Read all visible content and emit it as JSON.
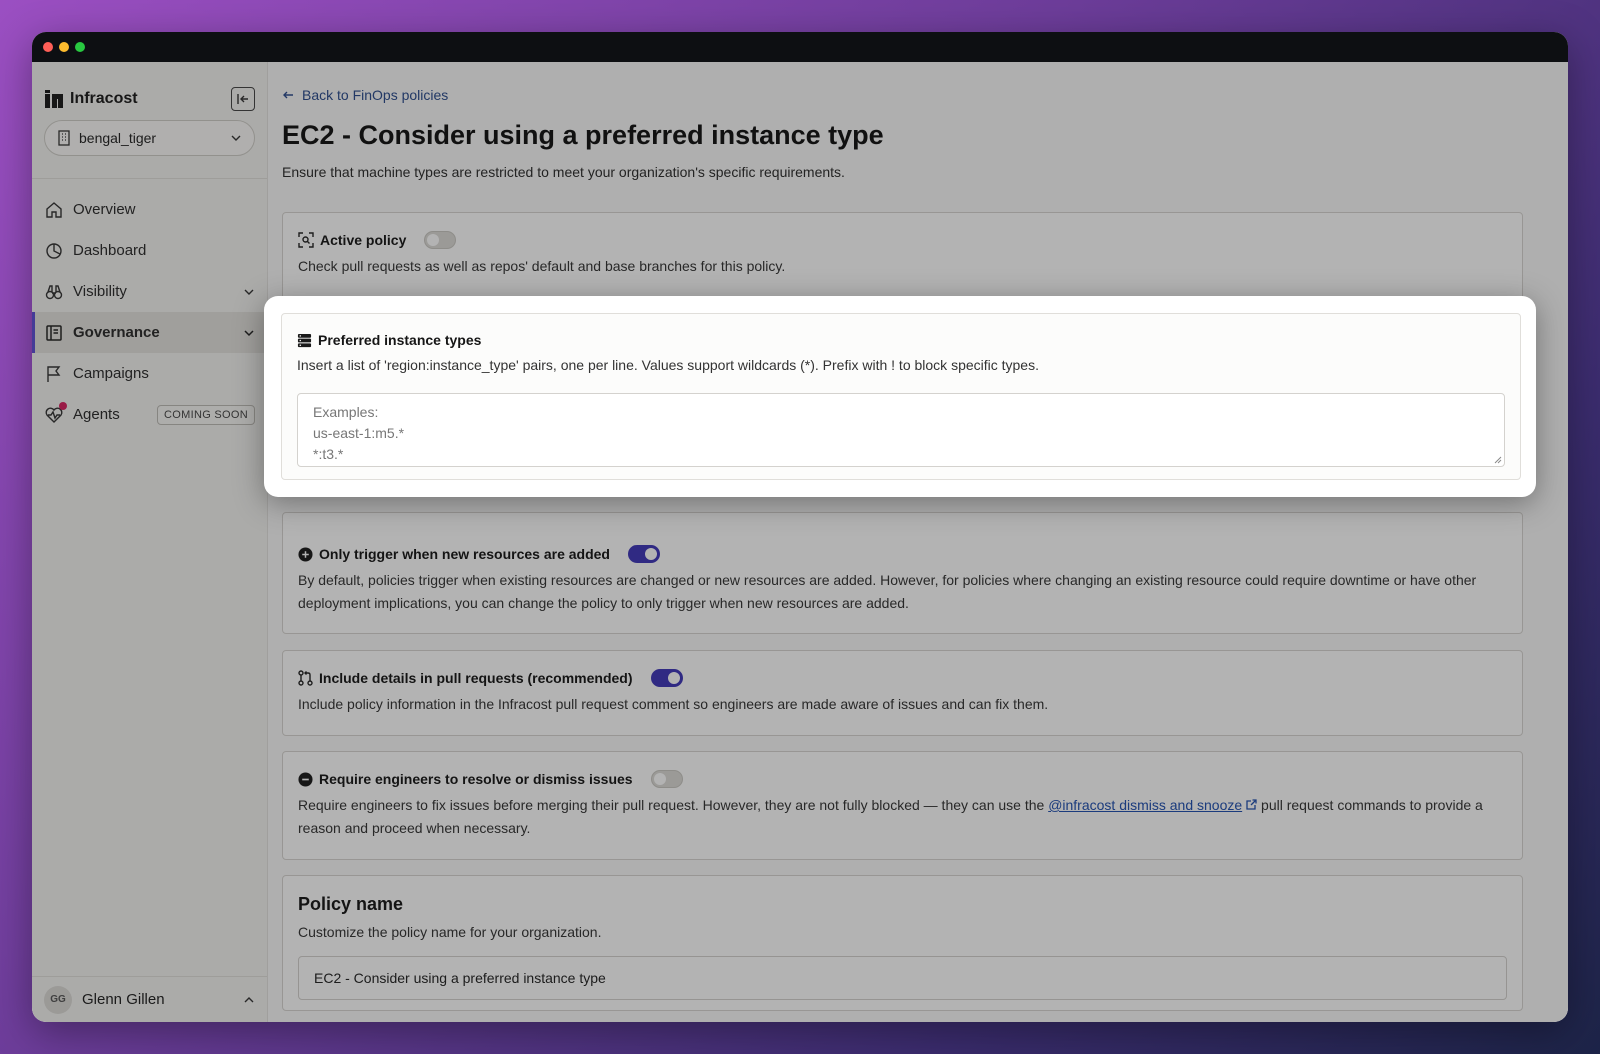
{
  "brand": {
    "name": "Infracost"
  },
  "org": {
    "name": "bengal_tiger"
  },
  "nav": {
    "items": [
      {
        "label": "Overview",
        "icon": "home-icon"
      },
      {
        "label": "Dashboard",
        "icon": "pie-chart-icon"
      },
      {
        "label": "Visibility",
        "icon": "binoculars-icon"
      },
      {
        "label": "Governance",
        "icon": "book-icon"
      },
      {
        "label": "Campaigns",
        "icon": "flag-icon"
      },
      {
        "label": "Agents",
        "icon": "heart-pulse-icon",
        "badge": "COMING SOON"
      }
    ]
  },
  "user": {
    "initials": "GG",
    "name": "Glenn Gillen"
  },
  "header": {
    "back_label": "Back to FinOps policies",
    "title": "EC2 - Consider using a preferred instance type",
    "subtitle": "Ensure that machine types are restricted to meet your organization's specific requirements."
  },
  "sections": {
    "active_policy": {
      "title": "Active policy",
      "desc": "Check pull requests as well as repos' default and base branches for this policy.",
      "enabled": false
    },
    "preferred": {
      "title": "Preferred instance types",
      "desc": "Insert a list of 'region:instance_type' pairs, one per line. Values support wildcards (*). Prefix with ! to block specific types.",
      "placeholder_lines": [
        "Examples:",
        "us-east-1:m5.*",
        "*:t3.*"
      ]
    },
    "only_trigger": {
      "title": "Only trigger when new resources are added",
      "desc": "By default, policies trigger when existing resources are changed or new resources are added. However, for policies where changing an existing resource could require downtime or have other deployment implications, you can change the policy to only trigger when new resources are added.",
      "enabled": true
    },
    "include_details": {
      "title": "Include details in pull requests (recommended)",
      "desc": "Include policy information in the Infracost pull request comment so engineers are made aware of issues and can fix them.",
      "enabled": true
    },
    "require_resolve": {
      "title": "Require engineers to resolve or dismiss issues",
      "desc_before": "Require engineers to fix issues before merging their pull request. However, they are not fully blocked — they can use the ",
      "link": "@infracost dismiss and snooze",
      "desc_after": " pull request commands to provide a reason and proceed when necessary.",
      "enabled": false
    },
    "policy_name": {
      "title": "Policy name",
      "desc": "Customize the policy name for your organization.",
      "value": "EC2 - Consider using a preferred instance type"
    }
  },
  "colors": {
    "accent": "#3f36b8",
    "link": "#1f4fb0",
    "active_indicator": "#5d4fd6"
  }
}
